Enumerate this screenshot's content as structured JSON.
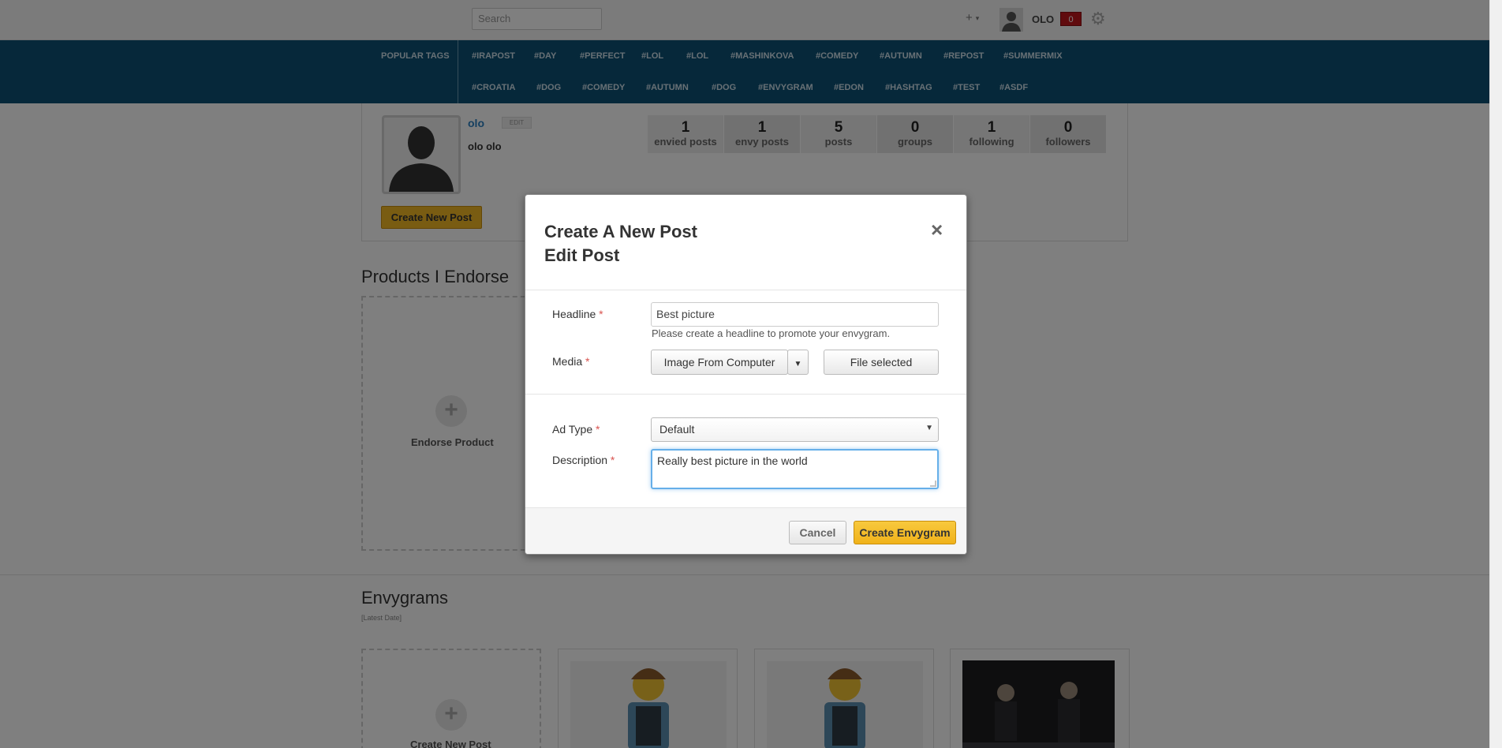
{
  "topbar": {
    "search_placeholder": "Search",
    "plus_icon": "+",
    "user_name": "OLO",
    "notifications": "0"
  },
  "tagbar": {
    "title": "POPULAR TAGS",
    "row1": [
      "#IRAPOST",
      "#DAY",
      "#PERFECT",
      "#LOL",
      "#LOL",
      "#MASHINKOVA",
      "#COMEDY",
      "#AUTUMN",
      "#REPOST",
      "#SUMMERMIX"
    ],
    "row2": [
      "#CROATIA",
      "#DOG",
      "#COMEDY",
      "#AUTUMN",
      "#DOG",
      "#ENVYGRAM",
      "#EDON",
      "#HASHTAG",
      "#TEST",
      "#ASDF"
    ]
  },
  "profile": {
    "name": "olo",
    "edit_label": "EDIT",
    "full_name": "olo olo",
    "create_post_label": "Create New Post",
    "stats": [
      {
        "num": "1",
        "label": "envied posts"
      },
      {
        "num": "1",
        "label": "envy posts"
      },
      {
        "num": "5",
        "label": "posts"
      },
      {
        "num": "0",
        "label": "groups"
      },
      {
        "num": "1",
        "label": "following"
      },
      {
        "num": "0",
        "label": "followers"
      }
    ]
  },
  "products": {
    "title": "Products I Endorse",
    "endorse_label": "Endorse Product"
  },
  "envygrams": {
    "title": "Envygrams",
    "sort": "[Latest Date]",
    "create_label": "Create New Post"
  },
  "modal": {
    "title_line1": "Create A New Post",
    "title_line2": "Edit Post",
    "close": "×",
    "required_mark": "*",
    "headline_label": "Headline",
    "headline_value": "Best picture",
    "headline_help": "Please create a headline to promote your envygram.",
    "media_label": "Media",
    "media_source": "Image From Computer",
    "file_button": "File selected",
    "adtype_label": "Ad Type",
    "adtype_value": "Default",
    "description_label": "Description",
    "description_value": "Really best picture in the world",
    "cancel_label": "Cancel",
    "create_label": "Create Envygram"
  }
}
